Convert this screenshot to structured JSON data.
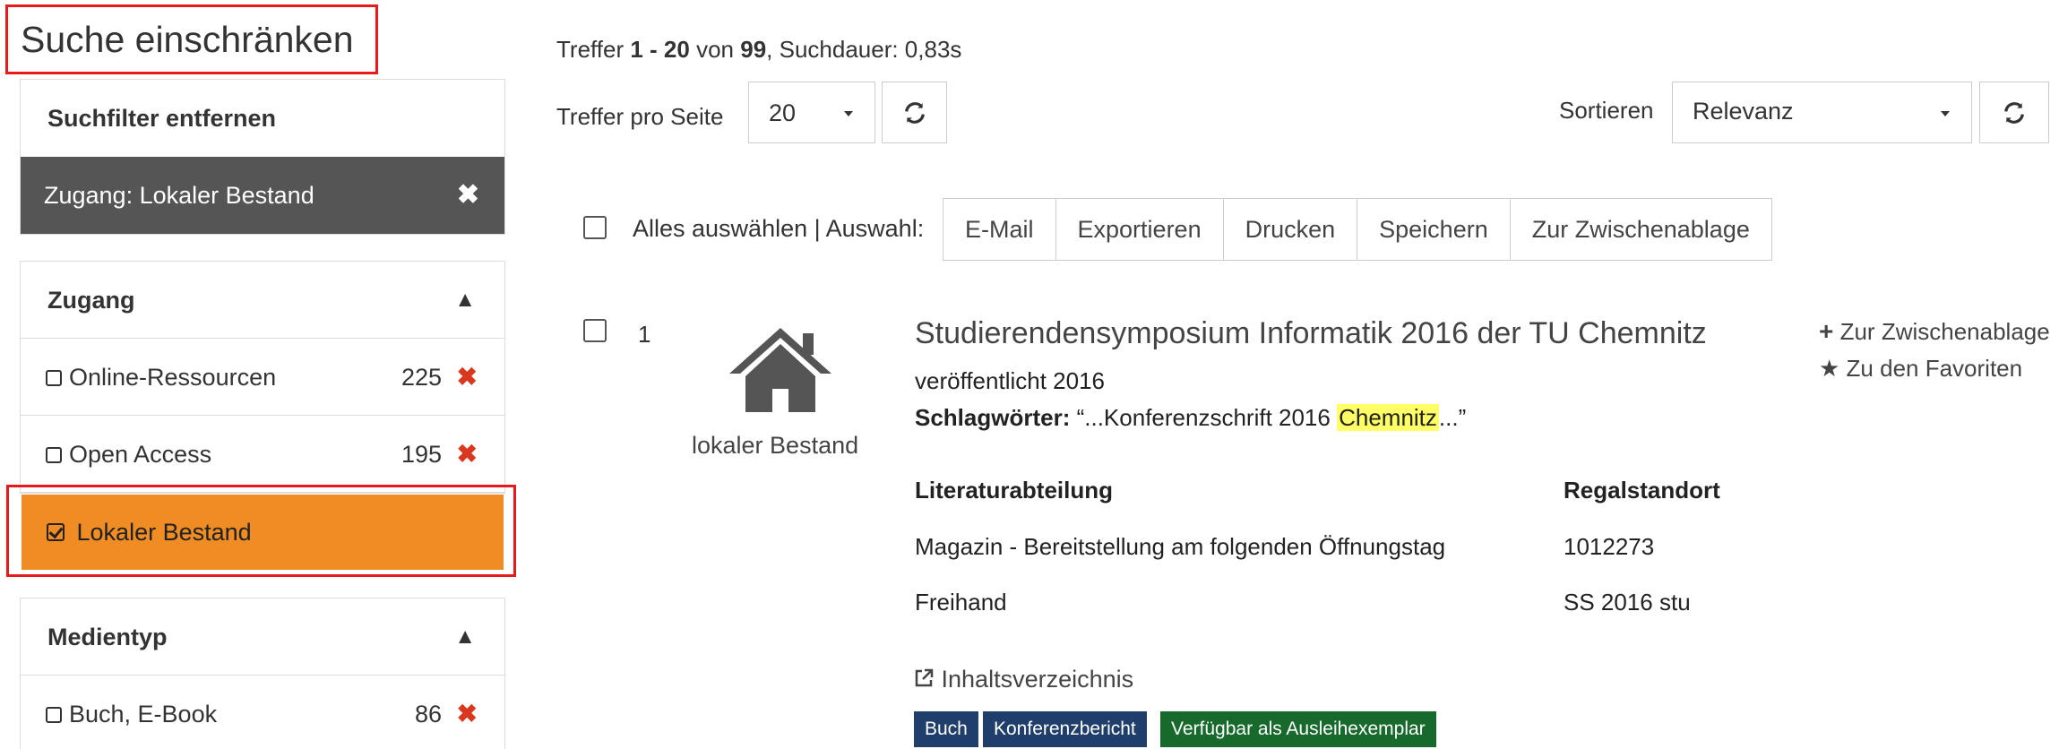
{
  "sidebar": {
    "title": "Suche einschränken",
    "remove_filters": {
      "heading": "Suchfilter entfernen",
      "active_filter": "Zugang: Lokaler Bestand"
    },
    "zugang": {
      "heading": "Zugang",
      "items": [
        {
          "label": "Online-Ressourcen",
          "count": "225"
        },
        {
          "label": "Open Access",
          "count": "195"
        }
      ],
      "selected_item": "Lokaler Bestand"
    },
    "medientyp": {
      "heading": "Medientyp",
      "items": [
        {
          "label": "Buch, E-Book",
          "count": "86"
        }
      ]
    }
  },
  "results": {
    "summary_prefix": "Treffer ",
    "range": "1 - 20",
    "of": " von ",
    "total": "99",
    "duration": ", Suchdauer: 0,83s",
    "per_page_label": "Treffer pro Seite",
    "per_page_value": "20",
    "sort_label": "Sortieren",
    "sort_value": "Relevanz"
  },
  "toolbar": {
    "select_all": "Alles auswählen | Auswahl:",
    "buttons": [
      "E-Mail",
      "Exportieren",
      "Drucken",
      "Speichern",
      "Zur Zwischenablage"
    ]
  },
  "record": {
    "number": "1",
    "icon_label": "lokaler Bestand",
    "title": "Studierendensymposium Informatik 2016 der TU Chemnitz",
    "published": "veröffentlicht 2016",
    "subjects_label": "Schlagwörter:",
    "subjects_before": " “...Konferenzschrift 2016 ",
    "subjects_highlight": "Chemnitz",
    "subjects_after": "...”",
    "holdings_header": [
      "Literaturabteilung",
      "Regalstandort"
    ],
    "holdings": [
      {
        "dept": "Magazin - Bereitstellung am folgenden Öffnungstag",
        "shelf": "1012273"
      },
      {
        "dept": "Freihand",
        "shelf": "SS 2016 stu"
      }
    ],
    "toc_link": "Inhaltsverzeichnis",
    "actions": [
      "Zur Zwischenablage",
      "Zu den Favoriten"
    ],
    "badges": [
      {
        "label": "Buch",
        "color": "#1f3e6b"
      },
      {
        "label": "Konferenzbericht",
        "color": "#1f3e6b"
      },
      {
        "label": "Verfügbar als Ausleihexemplar",
        "color": "#176a2b"
      }
    ]
  }
}
